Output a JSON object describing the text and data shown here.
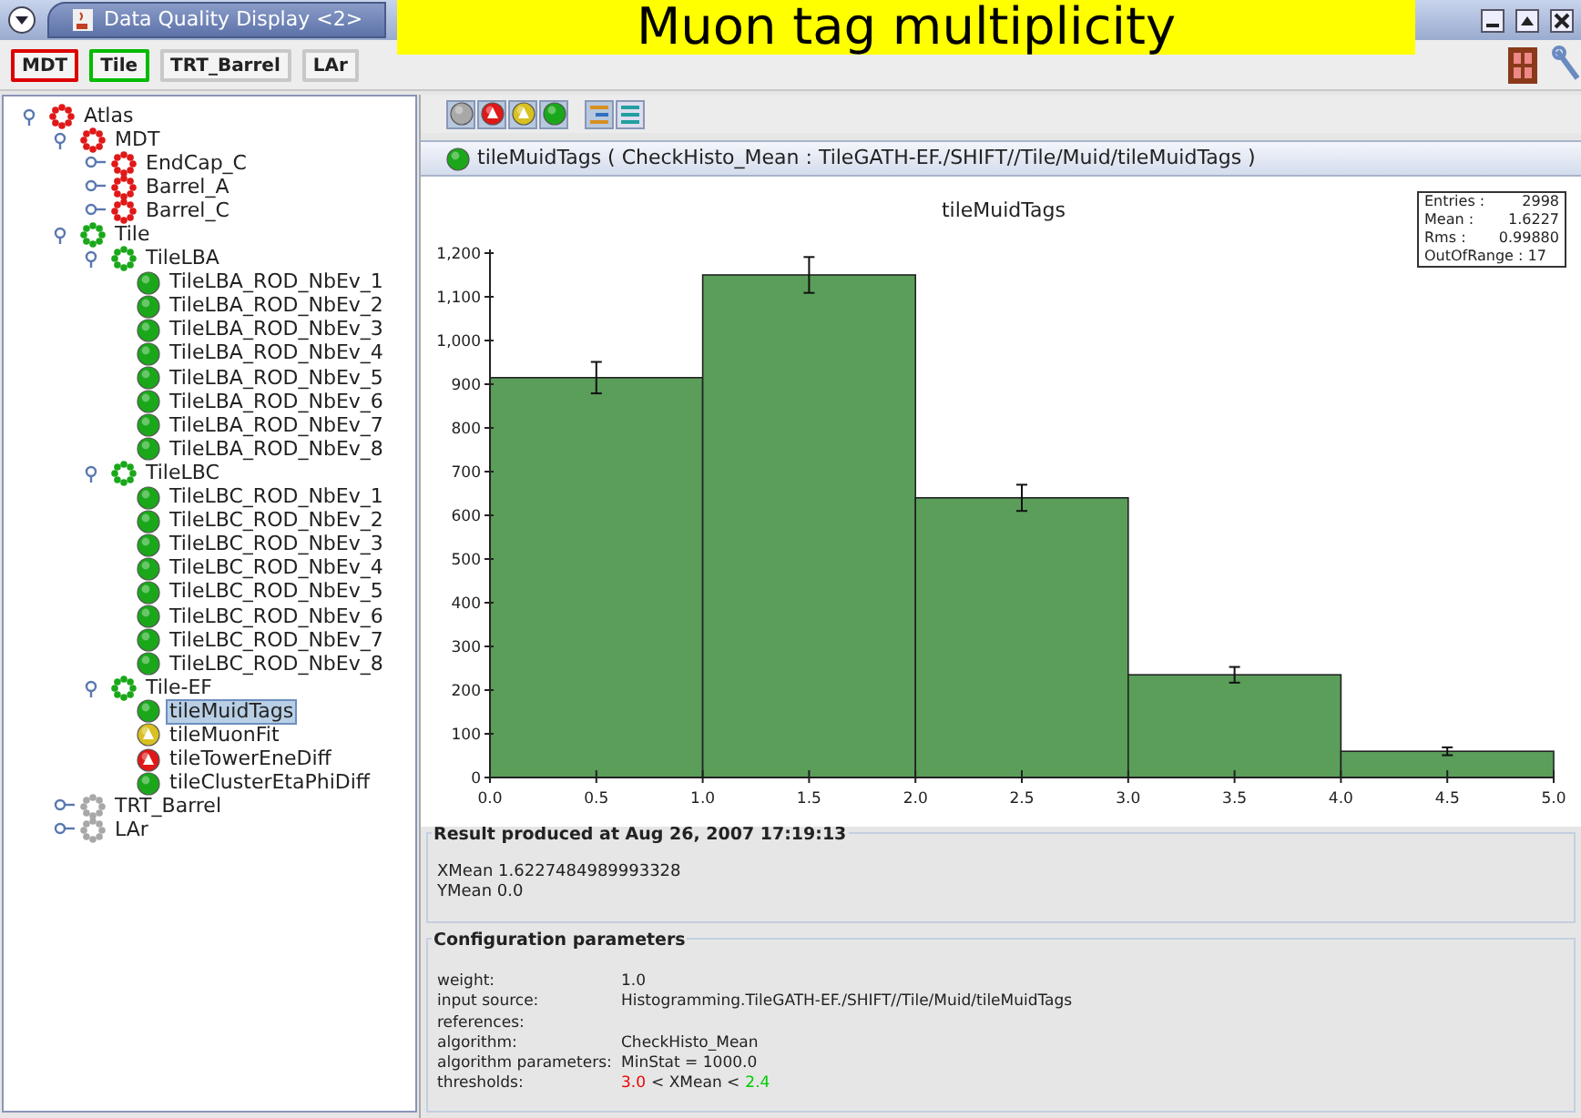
{
  "caption": "Muon tag multiplicity",
  "window": {
    "title": "Data Quality Display <2>"
  },
  "toolbar": {
    "buttons": [
      {
        "label": "MDT",
        "color": "#dd0000"
      },
      {
        "label": "Tile",
        "color": "#00bb00"
      },
      {
        "label": "TRT_Barrel"
      },
      {
        "label": "LAr"
      }
    ]
  },
  "tree": [
    {
      "label": "Atlas",
      "color": "#e01818",
      "kind": "group",
      "expanded": true,
      "selected": false,
      "children": [
        {
          "label": "MDT",
          "color": "#e01818",
          "kind": "group",
          "expanded": true,
          "selected": false,
          "children": [
            {
              "label": "EndCap_C",
              "color": "#e01818",
              "kind": "group",
              "expanded": false,
              "selected": false
            },
            {
              "label": "Barrel_A",
              "color": "#e01818",
              "kind": "group",
              "expanded": false,
              "selected": false
            },
            {
              "label": "Barrel_C",
              "color": "#e01818",
              "kind": "group",
              "expanded": false,
              "selected": false
            }
          ]
        },
        {
          "label": "Tile",
          "color": "#1aa81a",
          "kind": "group",
          "expanded": true,
          "selected": false,
          "children": [
            {
              "label": "TileLBA",
              "color": "#1aa81a",
              "kind": "group",
              "expanded": true,
              "selected": false,
              "children": [
                {
                  "label": "TileLBA_ROD_NbEv_1",
                  "color": "#1aa81a",
                  "kind": "check",
                  "alert": false,
                  "selected": false
                },
                {
                  "label": "TileLBA_ROD_NbEv_2",
                  "color": "#1aa81a",
                  "kind": "check",
                  "alert": false,
                  "selected": false
                },
                {
                  "label": "TileLBA_ROD_NbEv_3",
                  "color": "#1aa81a",
                  "kind": "check",
                  "alert": false,
                  "selected": false
                },
                {
                  "label": "TileLBA_ROD_NbEv_4",
                  "color": "#1aa81a",
                  "kind": "check",
                  "alert": false,
                  "selected": false
                },
                {
                  "label": "TileLBA_ROD_NbEv_5",
                  "color": "#1aa81a",
                  "kind": "check",
                  "alert": false,
                  "selected": false
                },
                {
                  "label": "TileLBA_ROD_NbEv_6",
                  "color": "#1aa81a",
                  "kind": "check",
                  "alert": false,
                  "selected": false
                },
                {
                  "label": "TileLBA_ROD_NbEv_7",
                  "color": "#1aa81a",
                  "kind": "check",
                  "alert": false,
                  "selected": false
                },
                {
                  "label": "TileLBA_ROD_NbEv_8",
                  "color": "#1aa81a",
                  "kind": "check",
                  "alert": false,
                  "selected": false
                }
              ]
            },
            {
              "label": "TileLBC",
              "color": "#1aa81a",
              "kind": "group",
              "expanded": true,
              "selected": false,
              "children": [
                {
                  "label": "TileLBC_ROD_NbEv_1",
                  "color": "#1aa81a",
                  "kind": "check",
                  "alert": false,
                  "selected": false
                },
                {
                  "label": "TileLBC_ROD_NbEv_2",
                  "color": "#1aa81a",
                  "kind": "check",
                  "alert": false,
                  "selected": false
                },
                {
                  "label": "TileLBC_ROD_NbEv_3",
                  "color": "#1aa81a",
                  "kind": "check",
                  "alert": false,
                  "selected": false
                },
                {
                  "label": "TileLBC_ROD_NbEv_4",
                  "color": "#1aa81a",
                  "kind": "check",
                  "alert": false,
                  "selected": false
                },
                {
                  "label": "TileLBC_ROD_NbEv_5",
                  "color": "#1aa81a",
                  "kind": "check",
                  "alert": false,
                  "selected": false
                },
                {
                  "label": "TileLBC_ROD_NbEv_6",
                  "color": "#1aa81a",
                  "kind": "check",
                  "alert": false,
                  "selected": false
                },
                {
                  "label": "TileLBC_ROD_NbEv_7",
                  "color": "#1aa81a",
                  "kind": "check",
                  "alert": false,
                  "selected": false
                },
                {
                  "label": "TileLBC_ROD_NbEv_8",
                  "color": "#1aa81a",
                  "kind": "check",
                  "alert": false,
                  "selected": false
                }
              ]
            },
            {
              "label": "Tile-EF",
              "color": "#1aa81a",
              "kind": "group",
              "expanded": true,
              "selected": false,
              "children": [
                {
                  "label": "tileMuidTags",
                  "color": "#1aa81a",
                  "kind": "check",
                  "alert": false,
                  "selected": true
                },
                {
                  "label": "tileMuonFit",
                  "color": "#d8c020",
                  "kind": "check",
                  "alert": true,
                  "selected": false
                },
                {
                  "label": "tileTowerEneDiff",
                  "color": "#e01818",
                  "kind": "check",
                  "alert": true,
                  "selected": false
                },
                {
                  "label": "tileClusterEtaPhiDiff",
                  "color": "#1aa81a",
                  "kind": "check",
                  "alert": false,
                  "selected": false
                }
              ]
            }
          ]
        },
        {
          "label": "TRT_Barrel",
          "color": "#a8a8a8",
          "kind": "group",
          "expanded": false,
          "selected": false
        },
        {
          "label": "LAr",
          "color": "#a8a8a8",
          "kind": "group",
          "expanded": false,
          "selected": false
        }
      ]
    }
  ],
  "filters": [
    {
      "color": "#a8a8a8",
      "alert": false
    },
    {
      "color": "#e01818",
      "alert": true
    },
    {
      "color": "#d8c020",
      "alert": true
    },
    {
      "color": "#1aa81a",
      "alert": false
    }
  ],
  "result": {
    "color": "#1aa81a",
    "title": "tileMuidTags ( CheckHisto_Mean : TileGATH-EF./SHIFT//Tile/Muid/tileMuidTags )",
    "stats": [
      {
        "name": "Entries :",
        "value": "2998"
      },
      {
        "name": "Mean :",
        "value": "1.6227"
      },
      {
        "name": "Rms :",
        "value": "0.99880"
      },
      {
        "name": "OutOfRange : 17"
      }
    ],
    "chart_data": {
      "type": "bar",
      "title": "tileMuidTags",
      "x": [
        0.5,
        1.5,
        2.5,
        3.5,
        4.5
      ],
      "values": [
        915,
        1150,
        640,
        235,
        60
      ],
      "errors": [
        36,
        41,
        30,
        18,
        9
      ],
      "xlim": [
        0,
        5
      ],
      "ylim": [
        0,
        1200
      ],
      "xticks": [
        {
          "value": 0,
          "label": "0.0"
        },
        {
          "value": 0.5,
          "label": "0.5"
        },
        {
          "value": 1,
          "label": "1.0"
        },
        {
          "value": 1.5,
          "label": "1.5"
        },
        {
          "value": 2,
          "label": "2.0"
        },
        {
          "value": 2.5,
          "label": "2.5"
        },
        {
          "value": 3,
          "label": "3.0"
        },
        {
          "value": 3.5,
          "label": "3.5"
        },
        {
          "value": 4,
          "label": "4.0"
        },
        {
          "value": 4.5,
          "label": "4.5"
        },
        {
          "value": 5,
          "label": "5.0"
        }
      ],
      "yticks": [
        0,
        100,
        200,
        300,
        400,
        500,
        600,
        700,
        800,
        900,
        {
          "value": 1000,
          "label": "1,000"
        },
        {
          "value": 1100,
          "label": "1,100"
        },
        {
          "value": 1200,
          "label": "1,200"
        }
      ]
    },
    "produced": "Result produced at Aug 26, 2007 17:19:13",
    "values": [
      "XMean 1.6227484989993328",
      "YMean 0.0"
    ]
  },
  "config": {
    "title": "Configuration parameters",
    "rows": [
      {
        "name": "weight:",
        "value": "1.0"
      },
      {
        "name": "input source:",
        "value": "Histogramming.TileGATH-EF./SHIFT//Tile/Muid/tileMuidTags"
      },
      {
        "name": "references:"
      },
      {
        "name": "algorithm:",
        "value": "CheckHisto_Mean"
      },
      {
        "name": "algorithm parameters:",
        "value": "MinStat = 1000.0"
      },
      {
        "name": "thresholds:",
        "parts": [
          {
            "text": "3.0",
            "color": "#ee0000"
          },
          {
            "text": "< XMean <",
            "color": "#222222"
          },
          {
            "text": "2.4",
            "color": "#00cc00"
          }
        ]
      }
    ]
  }
}
